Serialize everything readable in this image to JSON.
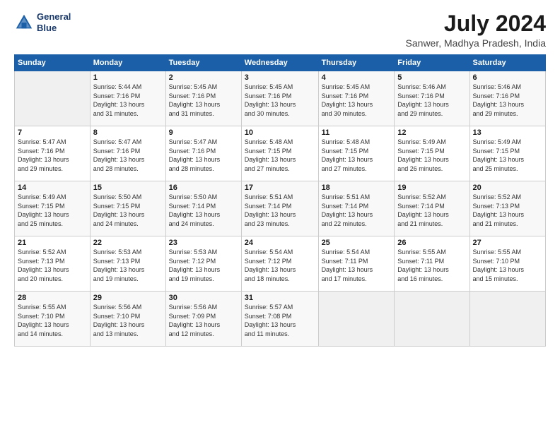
{
  "logo": {
    "line1": "General",
    "line2": "Blue"
  },
  "title": {
    "month_year": "July 2024",
    "location": "Sanwer, Madhya Pradesh, India"
  },
  "weekdays": [
    "Sunday",
    "Monday",
    "Tuesday",
    "Wednesday",
    "Thursday",
    "Friday",
    "Saturday"
  ],
  "weeks": [
    [
      {
        "num": "",
        "info": ""
      },
      {
        "num": "1",
        "info": "Sunrise: 5:44 AM\nSunset: 7:16 PM\nDaylight: 13 hours\nand 31 minutes."
      },
      {
        "num": "2",
        "info": "Sunrise: 5:45 AM\nSunset: 7:16 PM\nDaylight: 13 hours\nand 31 minutes."
      },
      {
        "num": "3",
        "info": "Sunrise: 5:45 AM\nSunset: 7:16 PM\nDaylight: 13 hours\nand 30 minutes."
      },
      {
        "num": "4",
        "info": "Sunrise: 5:45 AM\nSunset: 7:16 PM\nDaylight: 13 hours\nand 30 minutes."
      },
      {
        "num": "5",
        "info": "Sunrise: 5:46 AM\nSunset: 7:16 PM\nDaylight: 13 hours\nand 29 minutes."
      },
      {
        "num": "6",
        "info": "Sunrise: 5:46 AM\nSunset: 7:16 PM\nDaylight: 13 hours\nand 29 minutes."
      }
    ],
    [
      {
        "num": "7",
        "info": "Sunrise: 5:47 AM\nSunset: 7:16 PM\nDaylight: 13 hours\nand 29 minutes."
      },
      {
        "num": "8",
        "info": "Sunrise: 5:47 AM\nSunset: 7:16 PM\nDaylight: 13 hours\nand 28 minutes."
      },
      {
        "num": "9",
        "info": "Sunrise: 5:47 AM\nSunset: 7:16 PM\nDaylight: 13 hours\nand 28 minutes."
      },
      {
        "num": "10",
        "info": "Sunrise: 5:48 AM\nSunset: 7:15 PM\nDaylight: 13 hours\nand 27 minutes."
      },
      {
        "num": "11",
        "info": "Sunrise: 5:48 AM\nSunset: 7:15 PM\nDaylight: 13 hours\nand 27 minutes."
      },
      {
        "num": "12",
        "info": "Sunrise: 5:49 AM\nSunset: 7:15 PM\nDaylight: 13 hours\nand 26 minutes."
      },
      {
        "num": "13",
        "info": "Sunrise: 5:49 AM\nSunset: 7:15 PM\nDaylight: 13 hours\nand 25 minutes."
      }
    ],
    [
      {
        "num": "14",
        "info": "Sunrise: 5:49 AM\nSunset: 7:15 PM\nDaylight: 13 hours\nand 25 minutes."
      },
      {
        "num": "15",
        "info": "Sunrise: 5:50 AM\nSunset: 7:15 PM\nDaylight: 13 hours\nand 24 minutes."
      },
      {
        "num": "16",
        "info": "Sunrise: 5:50 AM\nSunset: 7:14 PM\nDaylight: 13 hours\nand 24 minutes."
      },
      {
        "num": "17",
        "info": "Sunrise: 5:51 AM\nSunset: 7:14 PM\nDaylight: 13 hours\nand 23 minutes."
      },
      {
        "num": "18",
        "info": "Sunrise: 5:51 AM\nSunset: 7:14 PM\nDaylight: 13 hours\nand 22 minutes."
      },
      {
        "num": "19",
        "info": "Sunrise: 5:52 AM\nSunset: 7:14 PM\nDaylight: 13 hours\nand 21 minutes."
      },
      {
        "num": "20",
        "info": "Sunrise: 5:52 AM\nSunset: 7:13 PM\nDaylight: 13 hours\nand 21 minutes."
      }
    ],
    [
      {
        "num": "21",
        "info": "Sunrise: 5:52 AM\nSunset: 7:13 PM\nDaylight: 13 hours\nand 20 minutes."
      },
      {
        "num": "22",
        "info": "Sunrise: 5:53 AM\nSunset: 7:13 PM\nDaylight: 13 hours\nand 19 minutes."
      },
      {
        "num": "23",
        "info": "Sunrise: 5:53 AM\nSunset: 7:12 PM\nDaylight: 13 hours\nand 19 minutes."
      },
      {
        "num": "24",
        "info": "Sunrise: 5:54 AM\nSunset: 7:12 PM\nDaylight: 13 hours\nand 18 minutes."
      },
      {
        "num": "25",
        "info": "Sunrise: 5:54 AM\nSunset: 7:11 PM\nDaylight: 13 hours\nand 17 minutes."
      },
      {
        "num": "26",
        "info": "Sunrise: 5:55 AM\nSunset: 7:11 PM\nDaylight: 13 hours\nand 16 minutes."
      },
      {
        "num": "27",
        "info": "Sunrise: 5:55 AM\nSunset: 7:10 PM\nDaylight: 13 hours\nand 15 minutes."
      }
    ],
    [
      {
        "num": "28",
        "info": "Sunrise: 5:55 AM\nSunset: 7:10 PM\nDaylight: 13 hours\nand 14 minutes."
      },
      {
        "num": "29",
        "info": "Sunrise: 5:56 AM\nSunset: 7:10 PM\nDaylight: 13 hours\nand 13 minutes."
      },
      {
        "num": "30",
        "info": "Sunrise: 5:56 AM\nSunset: 7:09 PM\nDaylight: 13 hours\nand 12 minutes."
      },
      {
        "num": "31",
        "info": "Sunrise: 5:57 AM\nSunset: 7:08 PM\nDaylight: 13 hours\nand 11 minutes."
      },
      {
        "num": "",
        "info": ""
      },
      {
        "num": "",
        "info": ""
      },
      {
        "num": "",
        "info": ""
      }
    ]
  ]
}
